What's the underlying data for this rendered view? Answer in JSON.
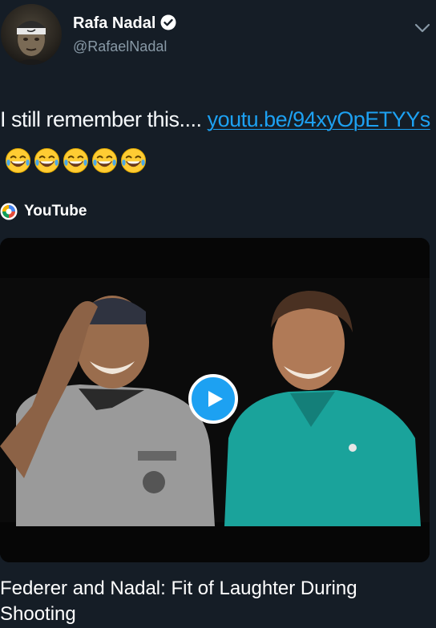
{
  "author": {
    "display_name": "Rafa Nadal",
    "handle": "@RafaelNadal",
    "verified": true,
    "avatar_icon": "profile-photo"
  },
  "tweet": {
    "text_prefix": "I still remember this....",
    "link_text": "youtu.be/94xyOpETYYs",
    "emoji": "face-with-tears-of-joy",
    "emoji_count": 5
  },
  "card": {
    "source_label": "YouTube",
    "source_icon": "youtube-icon",
    "play_icon": "play-icon",
    "title": "Federer and Nadal: Fit of Laughter During Shooting"
  },
  "colors": {
    "background": "#151d26",
    "link": "#1da1f2",
    "secondary_text": "#8899a6",
    "play_button": "#1da1f2"
  }
}
